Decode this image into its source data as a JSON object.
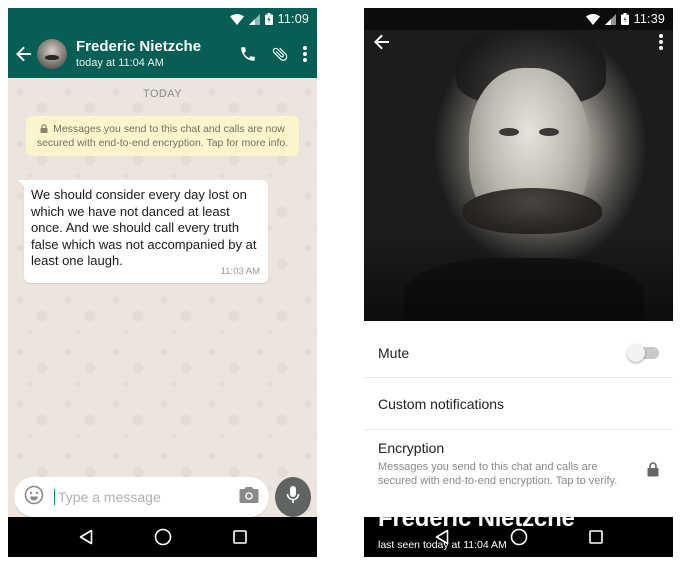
{
  "left_phone": {
    "status_time": "11:09",
    "contact_name": "Frederic Nietzche",
    "last_seen": "today at 11:04 AM",
    "date_chip": "TODAY",
    "encryption_notice": "Messages you send to this chat and calls are now secured with end-to-end encryption. Tap for more info.",
    "message": {
      "text": "We should consider every day lost on which we have not danced at least once. And we should call every truth false which was not accompanied by at least one laugh.",
      "time": "11:03 AM"
    },
    "input_placeholder": "Type a message",
    "icons": [
      "back-arrow-icon",
      "avatar",
      "phone-icon",
      "attach-icon",
      "more-vert-icon",
      "emoji-icon",
      "camera-icon",
      "mic-icon"
    ]
  },
  "right_phone": {
    "status_time": "11:39",
    "contact_name": "Frederic Nietzche",
    "last_seen": "last seen today at 11:04 AM",
    "settings": {
      "mute_label": "Mute",
      "mute_on": false,
      "custom_notifications_label": "Custom notifications",
      "encryption_label": "Encryption",
      "encryption_desc": "Messages you send to this chat and calls are secured with end-to-end encryption. Tap to verify."
    }
  },
  "colors": {
    "toolbar": "#075e54",
    "chat_bg": "#ece5dd",
    "notice_bg": "#fcf4cb",
    "mic_button": "#5f6362",
    "nav_bar": "#000000"
  }
}
